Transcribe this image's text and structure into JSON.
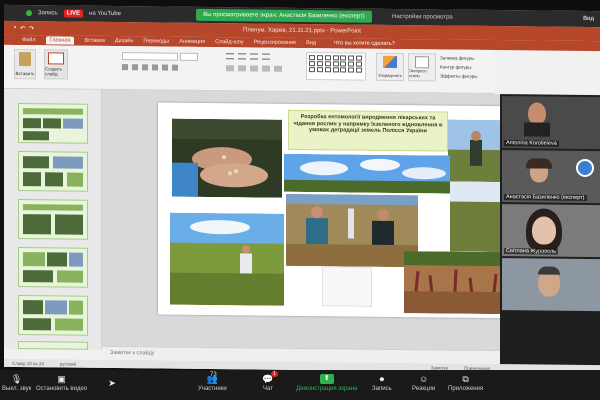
{
  "zoom_top": {
    "live_label": "LIVE",
    "stream_label": "Запись",
    "youtube_label": "на YouTube",
    "banner": "Вы просматриваете экран: Анастасія Базиленко (експерт)",
    "preferences": "Настройки просмотра",
    "view": "Вид"
  },
  "ppt": {
    "title": "Пленум, Харків, 21.11.21.pptx - PowerPoint",
    "tabs": [
      "Файл",
      "Главная",
      "Вставка",
      "Дизайн",
      "Переходы",
      "Анимация",
      "Слайд-шоу",
      "Рецензирование",
      "Вид"
    ],
    "alert": "Что вы хотите сделать?",
    "ribbon": {
      "paste": "Вставить",
      "new_slide": "Создать слайд",
      "font_name": "",
      "arrange": "Упорядочить",
      "styles": "Экспресс-стили",
      "fill": "Заливка фигуры",
      "outline": "Контур фигуры",
      "effects": "Эффекты фигуры"
    },
    "thumb_numbers": [
      "",
      "",
      "",
      "",
      "",
      ""
    ],
    "slide_title": "Розробка ентомології виродження лікарських та чідання рослин у напрямку їхзеленого відновлення в умовах деградації земель Полісся України",
    "notes": "Заметки к слайду",
    "status": [
      "Слайд 10 из 24",
      "русский"
    ],
    "status_right": [
      "Заметки",
      "Примечания"
    ]
  },
  "participants": [
    {
      "name": "Antonina Korotieieva"
    },
    {
      "name": "Анастасія Базиленко (експерт)"
    },
    {
      "name": "Світлана Журавель"
    },
    {
      "name": ""
    }
  ],
  "zoom_bottom": {
    "mute": "Выкл. звук",
    "video": "Остановить видео",
    "participants": "Участники",
    "participants_count": "73",
    "chat": "Чат",
    "chat_badge": "1",
    "share": "Демонстрация экрана",
    "record": "Запись",
    "reactions": "Реакции",
    "apps": "Приложения"
  }
}
